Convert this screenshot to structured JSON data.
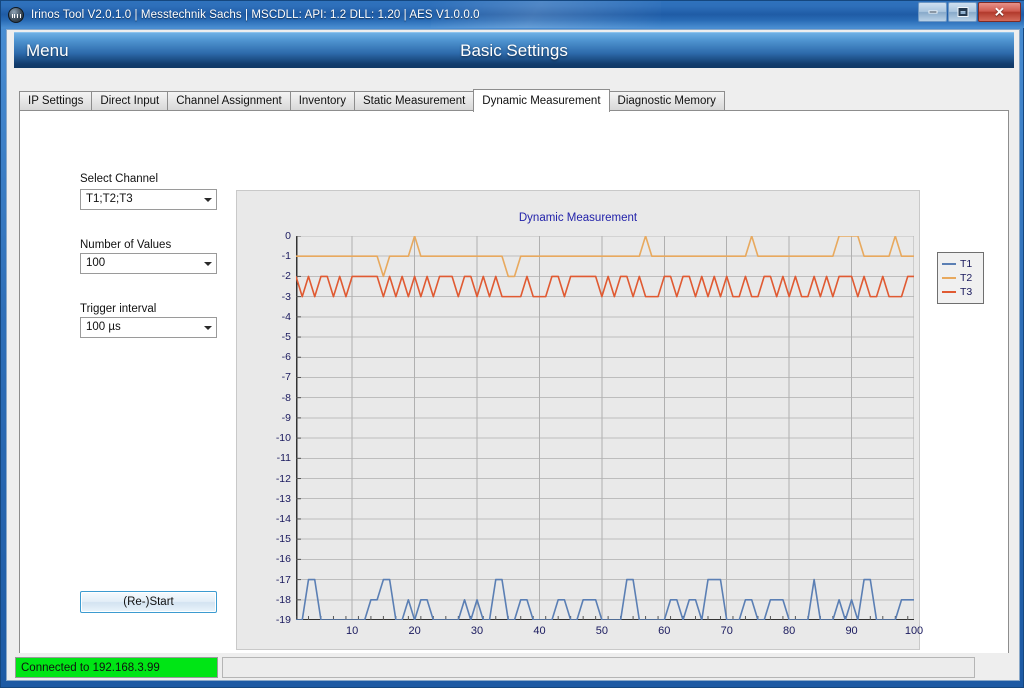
{
  "window": {
    "title": "Irinos Tool V2.0.1.0 | Messtechnik Sachs | MSCDLL: API: 1.2 DLL: 1.20 | AES V1.0.0.0",
    "app_icon": "waveform-icon",
    "controls": {
      "minimize": "minimize-icon",
      "maximize": "maximize-icon",
      "close": "✕"
    }
  },
  "header": {
    "menu_label": "Menu",
    "page_title": "Basic Settings"
  },
  "tabs": [
    {
      "label": "IP Settings",
      "active": false
    },
    {
      "label": "Direct Input",
      "active": false
    },
    {
      "label": "Channel Assignment",
      "active": false
    },
    {
      "label": "Inventory",
      "active": false
    },
    {
      "label": "Static Measurement",
      "active": false
    },
    {
      "label": "Dynamic Measurement",
      "active": true
    },
    {
      "label": "Diagnostic Memory",
      "active": false
    }
  ],
  "controls": {
    "select_channel": {
      "label": "Select Channel",
      "value": "T1;T2;T3"
    },
    "number_of_values": {
      "label": "Number of Values",
      "value": "100"
    },
    "trigger_interval": {
      "label": "Trigger interval",
      "value": "100 µs"
    },
    "start_button": {
      "label": "(Re-)Start"
    }
  },
  "statusbar": {
    "connection": "Connected to 192.168.3.99",
    "connection_color": "#00e515"
  },
  "chart_data": {
    "type": "line",
    "title": "Dynamic Measurement",
    "title_color": "#2222aa",
    "xlabel": "",
    "ylabel": "",
    "xlim": [
      1,
      100
    ],
    "ylim": [
      -19,
      0
    ],
    "xticks": [
      10,
      20,
      30,
      40,
      50,
      60,
      70,
      80,
      90,
      100
    ],
    "yticks": [
      0,
      -1,
      -2,
      -3,
      -4,
      -5,
      -6,
      -7,
      -8,
      -9,
      -10,
      -11,
      -12,
      -13,
      -14,
      -15,
      -16,
      -17,
      -18,
      -19
    ],
    "grid": true,
    "grid_color": "#bdbdbd",
    "plot_bg": "#e9e9e9",
    "legend_position": "right",
    "legend": [
      "T1",
      "T2",
      "T3"
    ],
    "series": [
      {
        "name": "T1",
        "color": "#5b7fb4",
        "values": [
          -19,
          -19,
          -17,
          -17,
          -19,
          -19,
          -19,
          -19,
          -19,
          -19,
          -19,
          -19,
          -18,
          -18,
          -17,
          -17,
          -19,
          -19,
          -18,
          -19,
          -18,
          -18,
          -19,
          -19,
          -19,
          -19,
          -19,
          -18,
          -19,
          -18,
          -19,
          -19,
          -17,
          -17,
          -19,
          -19,
          -18,
          -18,
          -19,
          -19,
          -19,
          -19,
          -18,
          -18,
          -19,
          -19,
          -18,
          -18,
          -18,
          -19,
          -19,
          -19,
          -19,
          -17,
          -17,
          -19,
          -19,
          -19,
          -19,
          -19,
          -18,
          -18,
          -19,
          -18,
          -18,
          -19,
          -17,
          -17,
          -17,
          -19,
          -19,
          -19,
          -18,
          -18,
          -19,
          -19,
          -18,
          -18,
          -18,
          -19,
          -19,
          -19,
          -19,
          -17,
          -19,
          -19,
          -19,
          -18,
          -19,
          -18,
          -19,
          -17,
          -17,
          -19,
          -19,
          -19,
          -19,
          -18,
          -18,
          -18
        ]
      },
      {
        "name": "T2",
        "color": "#e8a95e",
        "values": [
          -1,
          -1,
          -1,
          -1,
          -1,
          -1,
          -1,
          -1,
          -1,
          -1,
          -1,
          -1,
          -1,
          -1,
          -2,
          -1,
          -1,
          -1,
          -1,
          0,
          -1,
          -1,
          -1,
          -1,
          -1,
          -1,
          -1,
          -1,
          -1,
          -1,
          -1,
          -1,
          -1,
          -1,
          -2,
          -2,
          -1,
          -1,
          -1,
          -1,
          -1,
          -1,
          -1,
          -1,
          -1,
          -1,
          -1,
          -1,
          -1,
          -1,
          -1,
          -1,
          -1,
          -1,
          -1,
          -1,
          0,
          -1,
          -1,
          -1,
          -1,
          -1,
          -1,
          -1,
          -1,
          -1,
          -1,
          -1,
          -1,
          -1,
          -1,
          -1,
          -1,
          0,
          -1,
          -1,
          -1,
          -1,
          -1,
          -1,
          -1,
          -1,
          -1,
          -1,
          -1,
          -1,
          -1,
          0,
          0,
          0,
          0,
          -1,
          -1,
          -1,
          -1,
          -1,
          0,
          -1,
          -1,
          -1,
          -1
        ]
      },
      {
        "name": "T3",
        "color": "#e05a32",
        "values": [
          -2,
          -3,
          -2,
          -3,
          -2,
          -2,
          -3,
          -2,
          -3,
          -2,
          -2,
          -2,
          -2,
          -2,
          -3,
          -2,
          -3,
          -2,
          -3,
          -2,
          -3,
          -2,
          -3,
          -2,
          -2,
          -2,
          -3,
          -2,
          -2,
          -3,
          -2,
          -3,
          -2,
          -3,
          -3,
          -3,
          -3,
          -2,
          -3,
          -3,
          -3,
          -2,
          -2,
          -3,
          -2,
          -2,
          -2,
          -2,
          -2,
          -3,
          -2,
          -3,
          -2,
          -2,
          -3,
          -2,
          -3,
          -3,
          -3,
          -2,
          -2,
          -3,
          -2,
          -2,
          -3,
          -2,
          -3,
          -2,
          -3,
          -2,
          -3,
          -3,
          -2,
          -3,
          -3,
          -2,
          -2,
          -3,
          -2,
          -3,
          -2,
          -3,
          -3,
          -2,
          -3,
          -2,
          -3,
          -2,
          -2,
          -2,
          -3,
          -2,
          -3,
          -3,
          -2,
          -3,
          -3,
          -3,
          -2,
          -2
        ]
      }
    ]
  }
}
